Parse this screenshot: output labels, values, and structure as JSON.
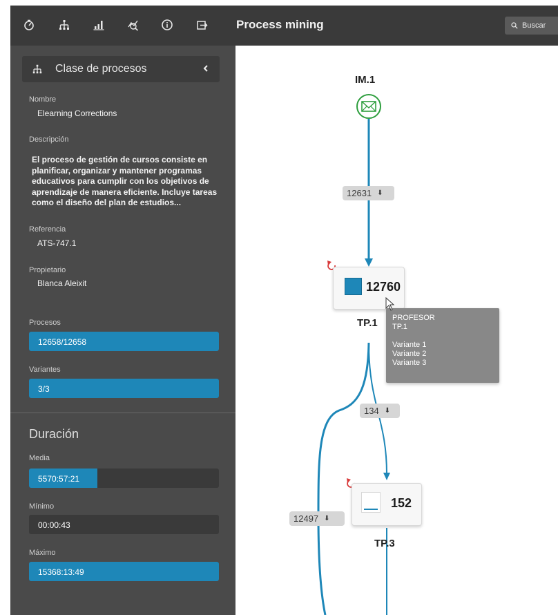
{
  "app": {
    "title": "Process mining",
    "search_label": "Buscar"
  },
  "toolbar_icons": [
    "timer-icon",
    "hierarchy-icon",
    "bar-chart-icon",
    "analytics-icon",
    "info-icon",
    "export-icon"
  ],
  "sidebar": {
    "header": "Clase de procesos",
    "name_label": "Nombre",
    "name_value": "Elearning Corrections",
    "description_label": "Descripción",
    "description_value": "El proceso de gestión de cursos consiste en planificar, organizar y mantener programas educativos para cumplir con los objetivos de aprendizaje de manera eficiente. Incluye tareas como el diseño del plan de estudios...",
    "reference_label": "Referencia",
    "reference_value": "ATS-747.1",
    "owner_label": "Propietario",
    "owner_value": "Blanca Aleixit",
    "processes_label": "Procesos",
    "processes_value": "12658/12658",
    "processes_fraction": 1.0,
    "variants_label": "Variantes",
    "variants_value": "3/3",
    "variants_fraction": 1.0,
    "duration_title": "Duración",
    "mean_label": "Media",
    "mean_value": "5570:57:21",
    "mean_fraction": 0.36,
    "min_label": "Mínimo",
    "min_value": "00:00:43",
    "min_fraction": 0,
    "max_label": "Máximo",
    "max_value": "15368:13:49",
    "max_fraction": 1.0
  },
  "process_map": {
    "start_node": {
      "label": "IM.1"
    },
    "nodes": [
      {
        "label": "TP.1",
        "count": "12760"
      },
      {
        "label": "TP.3",
        "count": "152"
      }
    ],
    "edges": [
      {
        "value": "12631"
      },
      {
        "value": "134"
      },
      {
        "value": "12497"
      }
    ],
    "tooltip": {
      "line1": "PROFESOR",
      "line2": "TP.1",
      "variants": [
        "Variante 1",
        "Variante 2",
        "Variante 3"
      ]
    }
  },
  "colors": {
    "accent": "#1e87b8",
    "sidebar_bg": "#4a4a4a",
    "topbar_bg": "#3a3a3a",
    "start_node": "#2e9e3e",
    "restart_icon": "#d93a3a"
  }
}
